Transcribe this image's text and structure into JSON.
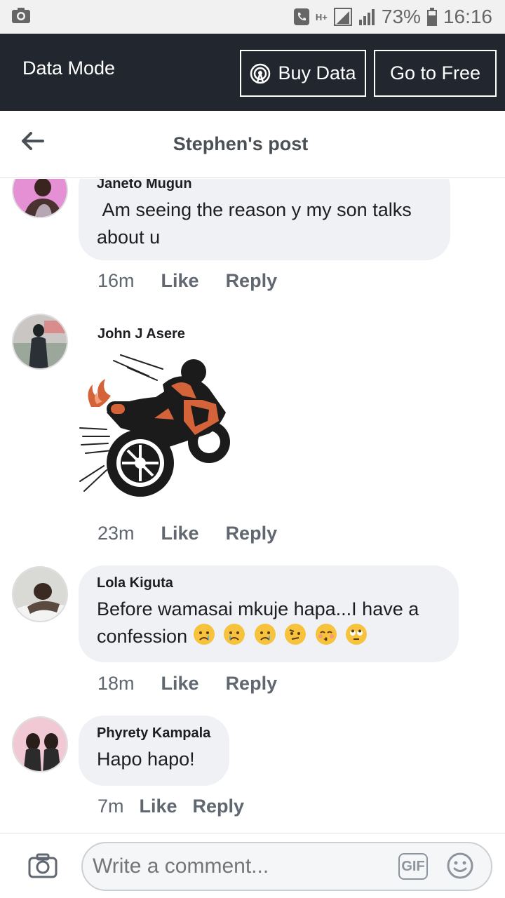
{
  "status_bar": {
    "battery": "73%",
    "time": "16:16",
    "network": "H+"
  },
  "data_bar": {
    "mode_label": "Data Mode",
    "buy_label": "Buy Data",
    "free_label": "Go to Free"
  },
  "nav": {
    "title": "Stephen's post"
  },
  "comments": [
    {
      "author": "Janeto Mugun",
      "text": " Am seeing the reason y my son talks about u",
      "time": "16m",
      "like": "Like",
      "reply": "Reply"
    },
    {
      "author": "John J Asere",
      "sticker": "motorcycle-sticker",
      "time": "23m",
      "like": "Like",
      "reply": "Reply"
    },
    {
      "author": "Lola Kiguta",
      "text": "Before wamasai mkuje hapa...I have a confession",
      "emojis": [
        "crying-face",
        "crying-face",
        "crying-face",
        "skeptical-face",
        "kissing-face",
        "eye-roll-face"
      ],
      "time": "18m",
      "like": "Like",
      "reply": "Reply"
    },
    {
      "author": "Phyrety Kampala",
      "text": "Hapo hapo!",
      "time": "7m",
      "like": "Like",
      "reply": "Reply"
    }
  ],
  "composer": {
    "placeholder": "Write a comment...",
    "gif_label": "GIF"
  },
  "colors": {
    "data_bar_bg": "#22262e",
    "bubble_bg": "#f0f1f4",
    "meta_text": "#606770"
  }
}
